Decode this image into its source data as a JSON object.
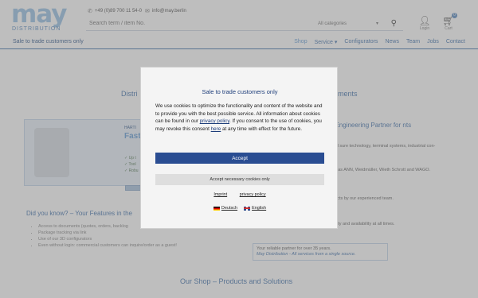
{
  "header": {
    "logo_word": "may",
    "logo_sub": "DISTRIBUTION",
    "phone": "+49 (0)89 700 11 54-0",
    "email": "info@may.berlin",
    "search_placeholder": "Search term / item No.",
    "category": "All categories",
    "login_label": "Login",
    "cart_label": "Cart",
    "cart_count": "0"
  },
  "navbar": {
    "trade_note": "Sale to trade customers only",
    "items": [
      {
        "label": "Shop",
        "active": true
      },
      {
        "label": "Service",
        "caret": "▾"
      },
      {
        "label": "Configurators"
      },
      {
        "label": "News"
      },
      {
        "label": "Team"
      },
      {
        "label": "Jobs"
      },
      {
        "label": "Contact"
      }
    ]
  },
  "page": {
    "section_left": "Distri",
    "section_right": "ments",
    "banner_brand": "HARTI",
    "banner_title": "Faste",
    "banner_checks": [
      "✓ Up t",
      "✓ Tool",
      "✓ Robu"
    ],
    "right_title": "r and Engineering Partner for nts",
    "right_paras": [
      "r 35,000 items for your electromechanical appl  sure technology, terminal systems, industrial con-",
      "were closely with leading manufacturers such as  ANN, Weidmüller, Wieth Schrott and WAGO.",
      "e range, we offer:",
      "mbled modules or custom-made enclosures  ucts  by our experienced team.",
      "warehousing to optimally meet our customers  ty and availability at all times."
    ],
    "box_text": "Your reliable partner for over 35 years.",
    "box_emph": "May Distribution - All services from a single source.",
    "dyk_title": "Did you know? – Your Features in the",
    "dyk_items": [
      "Access to documents (quotes, orders, backlog",
      "Package tracking via link",
      "Use of our 3D configurators",
      "Even without login: commercial customers can inquire/order as a guest!"
    ],
    "shop_title": "Our Shop – Products and Solutions"
  },
  "cookie": {
    "title": "Sale to trade customers only",
    "body_1": "We use cookies to optimize the functionality and content of the website and to provide you with the best possible service. All information about cookies can be found in our ",
    "body_link1": "privacy policy",
    "body_2": ". If you consent to the use of cookies, you may revoke this consent ",
    "body_link2": "here",
    "body_3": " at any time with effect for the future.",
    "accept": "Accept",
    "necessary": "Accept necessary cookies only",
    "imprint": "Imprint",
    "privacy": "privacy policy",
    "lang_de": "Deutsch",
    "lang_en": "English"
  },
  "colors": {
    "brand": "#4a78b0",
    "accent": "#2a4d92",
    "logo": "#9cc3e6"
  }
}
